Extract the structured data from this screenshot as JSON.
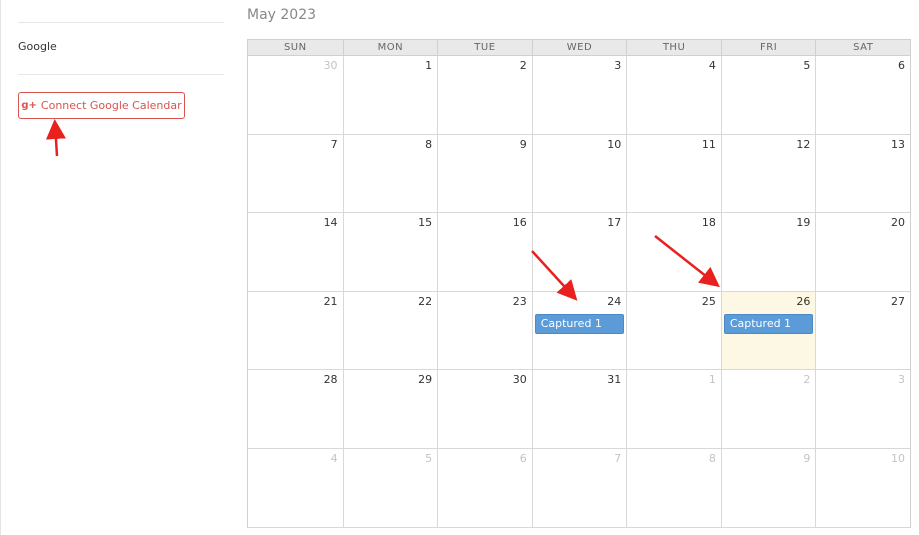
{
  "sidebar": {
    "provider_label": "Google",
    "connect_button_label": "Connect Google Calendar",
    "connect_icon": "google-plus-icon",
    "connect_icon_glyph": "g+",
    "accent_color": "#d9534f"
  },
  "calendar": {
    "month_title": "May 2023",
    "weekdays": [
      "SUN",
      "MON",
      "TUE",
      "WED",
      "THU",
      "FRI",
      "SAT"
    ],
    "today_color": "#fcf8e3",
    "event_color": "#5a9bd8",
    "weeks": [
      [
        {
          "n": "30",
          "other": true
        },
        {
          "n": "1"
        },
        {
          "n": "2"
        },
        {
          "n": "3"
        },
        {
          "n": "4"
        },
        {
          "n": "5"
        },
        {
          "n": "6"
        }
      ],
      [
        {
          "n": "7"
        },
        {
          "n": "8"
        },
        {
          "n": "9"
        },
        {
          "n": "10"
        },
        {
          "n": "11"
        },
        {
          "n": "12"
        },
        {
          "n": "13"
        }
      ],
      [
        {
          "n": "14"
        },
        {
          "n": "15"
        },
        {
          "n": "16"
        },
        {
          "n": "17"
        },
        {
          "n": "18"
        },
        {
          "n": "19"
        },
        {
          "n": "20"
        }
      ],
      [
        {
          "n": "21"
        },
        {
          "n": "22"
        },
        {
          "n": "23"
        },
        {
          "n": "24",
          "event": "Captured 1"
        },
        {
          "n": "25"
        },
        {
          "n": "26",
          "today": true,
          "event": "Captured 1"
        },
        {
          "n": "27"
        }
      ],
      [
        {
          "n": "28"
        },
        {
          "n": "29"
        },
        {
          "n": "30"
        },
        {
          "n": "31"
        },
        {
          "n": "1",
          "other": true
        },
        {
          "n": "2",
          "other": true
        },
        {
          "n": "3",
          "other": true
        }
      ],
      [
        {
          "n": "4",
          "other": true
        },
        {
          "n": "5",
          "other": true
        },
        {
          "n": "6",
          "other": true
        },
        {
          "n": "7",
          "other": true
        },
        {
          "n": "8",
          "other": true
        },
        {
          "n": "9",
          "other": true
        },
        {
          "n": "10",
          "other": true
        }
      ]
    ]
  },
  "annotations": {
    "arrow_color": "#e8211f"
  }
}
